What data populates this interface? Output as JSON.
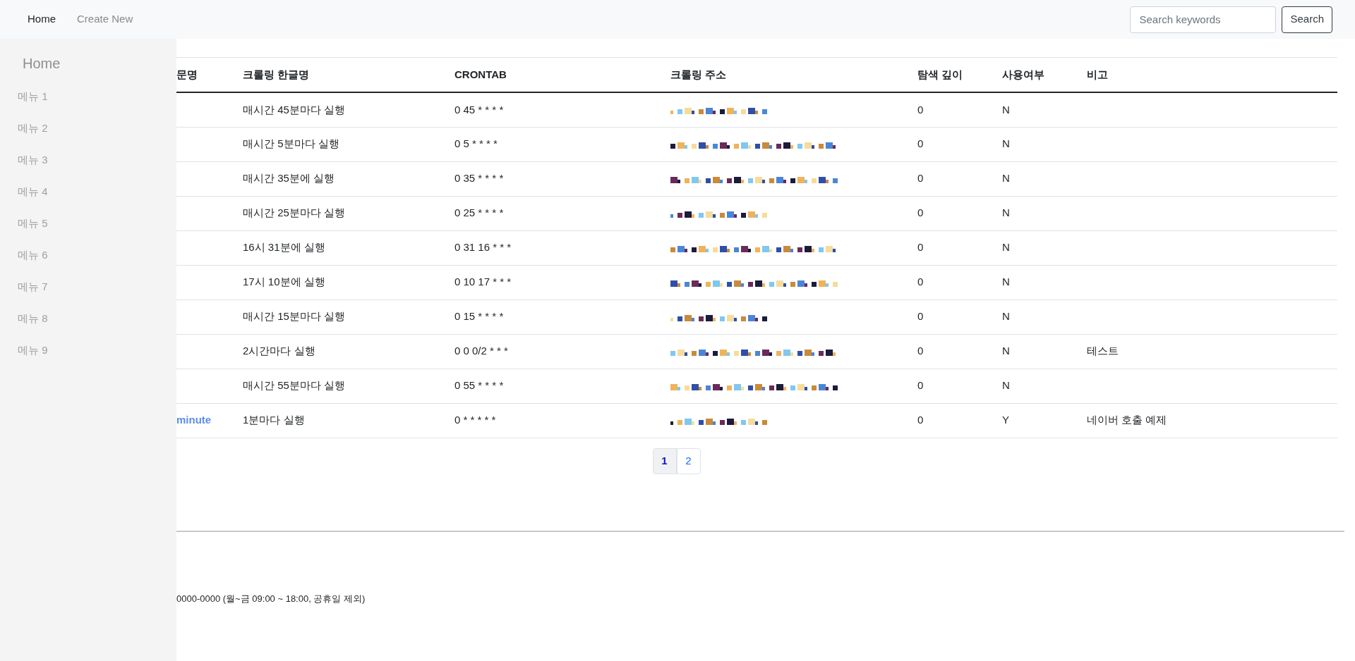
{
  "navbar": {
    "links": [
      {
        "label": "Home",
        "selected": true
      },
      {
        "label": "Create New",
        "selected": false
      }
    ],
    "search": {
      "placeholder": "Search keywords"
    },
    "search_button": "Search"
  },
  "sidebar": {
    "title": "Home",
    "items": [
      "메뉴 1",
      "메뉴 2",
      "메뉴 3",
      "메뉴 4",
      "메뉴 5",
      "메뉴 6",
      "메뉴 7",
      "메뉴 8",
      "메뉴 9"
    ]
  },
  "table": {
    "columns": [
      "문명",
      "크롤링 한글명",
      "CRONTAB",
      "크롤링 주소",
      "탐색 깊이",
      "사용여부",
      "비고"
    ],
    "rows": [
      {
        "english_name": "",
        "korean_name": "매시간 45분마다 실행",
        "crontab": "0 45 * * * *",
        "depth": "0",
        "in_use": "N",
        "note": ""
      },
      {
        "english_name": "",
        "korean_name": "매시간 5분마다 실행",
        "crontab": "0 5 * * * *",
        "depth": "0",
        "in_use": "N",
        "note": ""
      },
      {
        "english_name": "",
        "korean_name": "매시간 35분에 실행",
        "crontab": "0 35 * * * *",
        "depth": "0",
        "in_use": "N",
        "note": ""
      },
      {
        "english_name": "",
        "korean_name": "매시간 25분마다 실행",
        "crontab": "0 25 * * * *",
        "depth": "0",
        "in_use": "N",
        "note": ""
      },
      {
        "english_name": "",
        "korean_name": "16시 31분에 실행",
        "crontab": "0 31 16 * * *",
        "depth": "0",
        "in_use": "N",
        "note": ""
      },
      {
        "english_name": "",
        "korean_name": "17시 10분에 실행",
        "crontab": "0 10 17 * * *",
        "depth": "0",
        "in_use": "N",
        "note": ""
      },
      {
        "english_name": "",
        "korean_name": "매시간 15분마다 실행",
        "crontab": "0 15 * * * *",
        "depth": "0",
        "in_use": "N",
        "note": ""
      },
      {
        "english_name": "",
        "korean_name": "2시간마다 실행",
        "crontab": "0 0 0/2 * * *",
        "depth": "0",
        "in_use": "N",
        "note": "테스트"
      },
      {
        "english_name": "",
        "korean_name": "매시간 55분마다 실행",
        "crontab": "0 55 * * * *",
        "depth": "0",
        "in_use": "N",
        "note": ""
      },
      {
        "english_name": "minute",
        "korean_name": "1분마다 실행",
        "crontab": "0 * * * * *",
        "depth": "0",
        "in_use": "Y",
        "note": "네이버 호출 예제"
      }
    ]
  },
  "pagination": [
    {
      "label": "1",
      "selected": true
    },
    {
      "label": "2",
      "selected": false
    }
  ],
  "footer": {
    "contact": "0000-0000 (월~금 09:00 ~ 18:00, 공휴일 제외)"
  }
}
